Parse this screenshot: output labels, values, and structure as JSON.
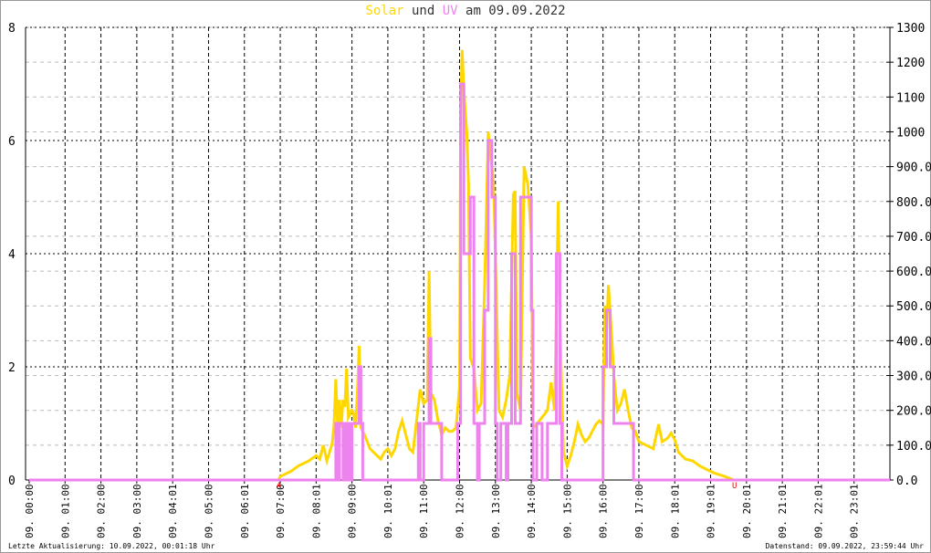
{
  "title": {
    "solar": "Solar",
    "und": "und",
    "uv": "UV",
    "rest": "am 09.09.2022"
  },
  "footer": {
    "left": "Letzte Aktualisierung: 10.09.2022, 00:01:18 Uhr",
    "right": "Datenstand: 09.09.2022, 23:59:44 Uhr"
  },
  "chart_data": {
    "type": "line",
    "title": "Solar und UV am 09.09.2022",
    "colors": {
      "solar": "#FFD700",
      "uv": "#EE82EE",
      "marker": "#FF0000"
    },
    "x_unit": "hour of day",
    "xlim": [
      0,
      24
    ],
    "x_tick_labels": [
      "09. 00:00",
      "09. 01:00",
      "09. 02:00",
      "09. 03:00",
      "09. 04:01",
      "09. 05:00",
      "09. 06:01",
      "09. 07:00",
      "09. 08:01",
      "09. 09:00",
      "09. 10:01",
      "09. 11:00",
      "09. 12:00",
      "09. 13:00",
      "09. 14:00",
      "09. 15:00",
      "09. 16:00",
      "09. 17:00",
      "09. 18:01",
      "09. 19:01",
      "09. 20:01",
      "09. 21:01",
      "09. 22:01",
      "09. 23:01"
    ],
    "y_left": {
      "lim": [
        0,
        8
      ],
      "ticks": [
        "0",
        "2",
        "4",
        "6",
        "8"
      ]
    },
    "y_right": {
      "lim": [
        0,
        1300
      ],
      "ticks": [
        "0.0",
        "100.0",
        "200.0",
        "300.0",
        "400.0",
        "500.0",
        "600.0",
        "700.0",
        "800.0",
        "900.0",
        "1000",
        "1100",
        "1200",
        "1300"
      ]
    },
    "grid": true,
    "markers": [
      {
        "label": "A",
        "x": 7.0
      },
      {
        "label": "U",
        "x": 19.7
      }
    ],
    "series": [
      {
        "name": "Solar",
        "axis": "right",
        "points": [
          [
            0,
            0
          ],
          [
            6.95,
            0
          ],
          [
            7.0,
            10
          ],
          [
            7.3,
            25
          ],
          [
            7.5,
            40
          ],
          [
            7.8,
            55
          ],
          [
            8.0,
            70
          ],
          [
            8.1,
            60
          ],
          [
            8.2,
            100
          ],
          [
            8.3,
            55
          ],
          [
            8.45,
            105
          ],
          [
            8.5,
            160
          ],
          [
            8.55,
            290
          ],
          [
            8.6,
            150
          ],
          [
            8.65,
            230
          ],
          [
            8.7,
            150
          ],
          [
            8.75,
            230
          ],
          [
            8.8,
            210
          ],
          [
            8.85,
            320
          ],
          [
            8.9,
            180
          ],
          [
            9.0,
            200
          ],
          [
            9.05,
            190
          ],
          [
            9.1,
            150
          ],
          [
            9.15,
            250
          ],
          [
            9.2,
            385
          ],
          [
            9.25,
            150
          ],
          [
            9.35,
            130
          ],
          [
            9.5,
            90
          ],
          [
            9.7,
            70
          ],
          [
            9.8,
            60
          ],
          [
            9.9,
            80
          ],
          [
            10.0,
            90
          ],
          [
            10.1,
            70
          ],
          [
            10.2,
            90
          ],
          [
            10.3,
            140
          ],
          [
            10.4,
            170
          ],
          [
            10.5,
            130
          ],
          [
            10.6,
            90
          ],
          [
            10.7,
            80
          ],
          [
            10.8,
            170
          ],
          [
            10.9,
            260
          ],
          [
            11.0,
            220
          ],
          [
            11.1,
            230
          ],
          [
            11.15,
            600
          ],
          [
            11.2,
            250
          ],
          [
            11.3,
            230
          ],
          [
            11.4,
            170
          ],
          [
            11.5,
            130
          ],
          [
            11.6,
            150
          ],
          [
            11.7,
            140
          ],
          [
            11.8,
            140
          ],
          [
            11.9,
            150
          ],
          [
            12.0,
            270
          ],
          [
            12.03,
            1060
          ],
          [
            12.07,
            1235
          ],
          [
            12.12,
            1120
          ],
          [
            12.2,
            1000
          ],
          [
            12.25,
            850
          ],
          [
            12.3,
            350
          ],
          [
            12.4,
            320
          ],
          [
            12.5,
            200
          ],
          [
            12.6,
            220
          ],
          [
            12.7,
            560
          ],
          [
            12.8,
            1000
          ],
          [
            12.9,
            900
          ],
          [
            12.95,
            850
          ],
          [
            13.0,
            650
          ],
          [
            13.1,
            200
          ],
          [
            13.2,
            180
          ],
          [
            13.3,
            230
          ],
          [
            13.4,
            300
          ],
          [
            13.5,
            820
          ],
          [
            13.55,
            830
          ],
          [
            13.6,
            250
          ],
          [
            13.7,
            200
          ],
          [
            13.8,
            900
          ],
          [
            13.9,
            850
          ],
          [
            14.0,
            700
          ],
          [
            14.05,
            150
          ],
          [
            14.15,
            160
          ],
          [
            14.3,
            180
          ],
          [
            14.45,
            200
          ],
          [
            14.55,
            280
          ],
          [
            14.65,
            200
          ],
          [
            14.75,
            800
          ],
          [
            14.8,
            450
          ],
          [
            14.9,
            80
          ],
          [
            15.0,
            40
          ],
          [
            15.1,
            70
          ],
          [
            15.2,
            110
          ],
          [
            15.3,
            160
          ],
          [
            15.4,
            130
          ],
          [
            15.5,
            110
          ],
          [
            15.6,
            120
          ],
          [
            15.8,
            160
          ],
          [
            15.9,
            170
          ],
          [
            16.0,
            160
          ],
          [
            16.05,
            500
          ],
          [
            16.1,
            430
          ],
          [
            16.15,
            560
          ],
          [
            16.25,
            400
          ],
          [
            16.3,
            300
          ],
          [
            16.4,
            200
          ],
          [
            16.5,
            220
          ],
          [
            16.6,
            260
          ],
          [
            16.7,
            200
          ],
          [
            16.8,
            150
          ],
          [
            16.9,
            140
          ],
          [
            17.0,
            110
          ],
          [
            17.2,
            100
          ],
          [
            17.4,
            90
          ],
          [
            17.55,
            160
          ],
          [
            17.65,
            110
          ],
          [
            17.8,
            120
          ],
          [
            17.9,
            135
          ],
          [
            18.0,
            115
          ],
          [
            18.1,
            80
          ],
          [
            18.3,
            60
          ],
          [
            18.5,
            55
          ],
          [
            18.7,
            40
          ],
          [
            18.9,
            30
          ],
          [
            19.1,
            20
          ],
          [
            19.4,
            10
          ],
          [
            19.65,
            0
          ],
          [
            24,
            0
          ]
        ]
      },
      {
        "name": "UV",
        "axis": "left",
        "step": true,
        "points": [
          [
            0,
            0
          ],
          [
            8.55,
            1
          ],
          [
            8.6,
            0
          ],
          [
            8.65,
            1
          ],
          [
            8.75,
            0
          ],
          [
            8.78,
            1
          ],
          [
            8.85,
            0
          ],
          [
            8.88,
            1
          ],
          [
            8.95,
            0
          ],
          [
            9.0,
            1
          ],
          [
            9.2,
            2
          ],
          [
            9.25,
            1
          ],
          [
            9.3,
            0
          ],
          [
            10.85,
            1
          ],
          [
            10.9,
            0
          ],
          [
            11.0,
            1
          ],
          [
            11.15,
            2.5
          ],
          [
            11.2,
            1
          ],
          [
            11.5,
            0
          ],
          [
            11.95,
            1
          ],
          [
            12.03,
            7
          ],
          [
            12.12,
            4
          ],
          [
            12.3,
            5
          ],
          [
            12.4,
            1
          ],
          [
            12.5,
            0
          ],
          [
            12.55,
            1
          ],
          [
            12.7,
            3
          ],
          [
            12.8,
            6
          ],
          [
            12.9,
            5
          ],
          [
            13.0,
            1
          ],
          [
            13.05,
            0
          ],
          [
            13.15,
            1
          ],
          [
            13.3,
            0
          ],
          [
            13.35,
            1
          ],
          [
            13.45,
            4
          ],
          [
            13.55,
            1
          ],
          [
            13.7,
            5
          ],
          [
            13.85,
            5
          ],
          [
            14.0,
            3
          ],
          [
            14.05,
            0
          ],
          [
            14.15,
            1
          ],
          [
            14.3,
            0
          ],
          [
            14.45,
            1
          ],
          [
            14.7,
            4
          ],
          [
            14.8,
            1
          ],
          [
            14.85,
            0
          ],
          [
            16.0,
            2
          ],
          [
            16.1,
            3
          ],
          [
            16.2,
            2
          ],
          [
            16.3,
            1
          ],
          [
            16.85,
            0
          ],
          [
            24,
            0
          ]
        ]
      }
    ]
  }
}
